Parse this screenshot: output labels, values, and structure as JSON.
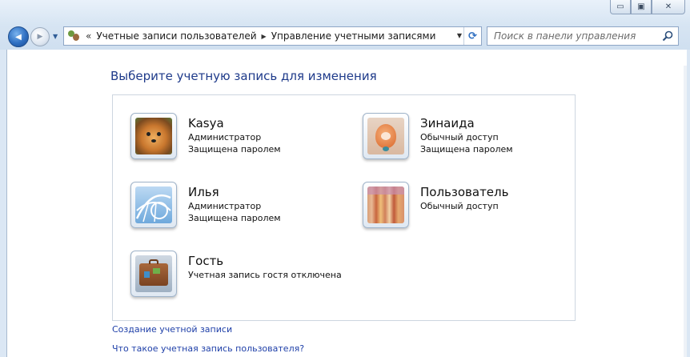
{
  "window": {
    "controls": {
      "minimize": "▭",
      "maximize": "▣",
      "close": "✕"
    }
  },
  "nav": {
    "back_glyph": "◀",
    "forward_glyph": "▶",
    "dropdown_glyph": "▼"
  },
  "address": {
    "overflow": "«",
    "crumbs": [
      "Учетные записи пользователей",
      "Управление учетными записями"
    ],
    "crumb_sep": "▶",
    "dropdown_glyph": "▼",
    "refresh_glyph": "⟳"
  },
  "search": {
    "placeholder": "Поиск в панели управления"
  },
  "main": {
    "title": "Выберите учетную запись для изменения",
    "accounts": [
      {
        "name": "Kasya",
        "lines": [
          "Администратор",
          "Защищена паролем"
        ],
        "picture": "dog-photo"
      },
      {
        "name": "Зинаида",
        "lines": [
          "Обычный доступ",
          "Защищена паролем"
        ],
        "picture": "orange-character"
      },
      {
        "name": "Илья",
        "lines": [
          "Администратор",
          "Защищена паролем"
        ],
        "picture": "rollercoaster"
      },
      {
        "name": "Пользователь",
        "lines": [
          "Обычный доступ"
        ],
        "picture": "fabric-stripes"
      },
      {
        "name": "Гость",
        "lines": [
          "Учетная запись гостя отключена"
        ],
        "picture": "suitcase"
      }
    ],
    "links": {
      "create": "Создание учетной записи",
      "what_is": "Что такое учетная запись пользователя?"
    }
  },
  "colors": {
    "link": "#1e3fa8",
    "title": "#1e3a8a",
    "chrome": "#d7e5f3"
  }
}
